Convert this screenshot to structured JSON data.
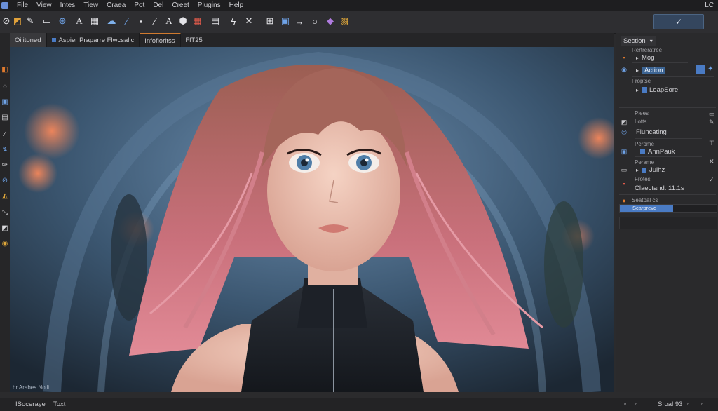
{
  "menubar": {
    "items": [
      "File",
      "View",
      "Intes",
      "Tiew",
      "Craea",
      "Pot",
      "Del",
      "Creet",
      "Plugins",
      "Help"
    ],
    "right_text": "LC"
  },
  "toolbar": {
    "ok_label": "✓"
  },
  "tabs": [
    {
      "label": "Oiiitoned"
    },
    {
      "label": "Aspier Praparre Flwcsalic"
    },
    {
      "label": "Infofloritss"
    },
    {
      "label": "FlT25"
    }
  ],
  "canvas": {
    "hint": "hr Arabes Nolli"
  },
  "right_panel": {
    "header": "Section",
    "small_labels": [
      "Rertreratree",
      "Froptse",
      "Piees",
      "Lotts",
      "Perome",
      "Perame",
      "Frotes"
    ],
    "rows": {
      "mog": "Mog",
      "action": "Action",
      "leapsore": "LeapSore",
      "fluncating": "Fluncating",
      "annpauk": "AnnPauk",
      "julhz": "Julhz",
      "claectand": "Claectand. 11:1s"
    },
    "bottom_small": "Seatpal cs",
    "progress_label": "Scarprevd",
    "progress": 0.55
  },
  "statusbar": {
    "left1": "ISoceraye",
    "left2": "Toxt",
    "right": "Sroal 93"
  },
  "colors": {
    "accent": "#4a7bc4",
    "orange": "#d07a2e",
    "panel": "#2a2a2c"
  }
}
